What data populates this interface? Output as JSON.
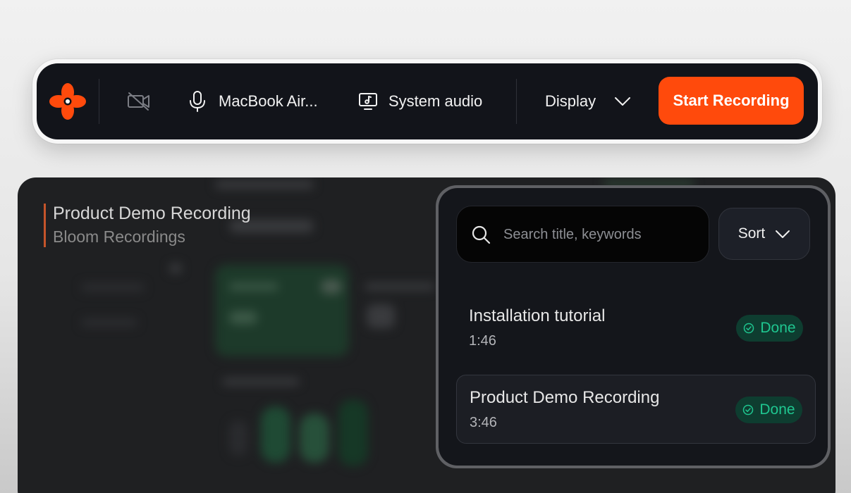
{
  "toolbar": {
    "mic_label": "MacBook Air...",
    "audio_label": "System audio",
    "display_label": "Display",
    "start_label": "Start Recording",
    "icons": {
      "logo": "bloom-flower-logo",
      "camera": "camera-off-icon",
      "mic": "microphone-icon",
      "audio": "monitor-audio-icon",
      "display": "chevron-down-icon"
    }
  },
  "document": {
    "title": "Product Demo Recording",
    "subtitle": "Bloom Recordings"
  },
  "panel": {
    "search_placeholder": "Search title, keywords",
    "search_value": "",
    "sort_label": "Sort",
    "recordings": [
      {
        "title": "Installation tutorial",
        "duration": "1:46",
        "status": "Done",
        "selected": false
      },
      {
        "title": "Product Demo Recording",
        "duration": "3:46",
        "status": "Done",
        "selected": true
      }
    ]
  },
  "colors": {
    "accent": "#ff4a0c",
    "toolbar_bg": "#12141a",
    "panel_bg": "#14161b",
    "done_text": "#1fc690",
    "done_bg": "#0e3d30"
  }
}
